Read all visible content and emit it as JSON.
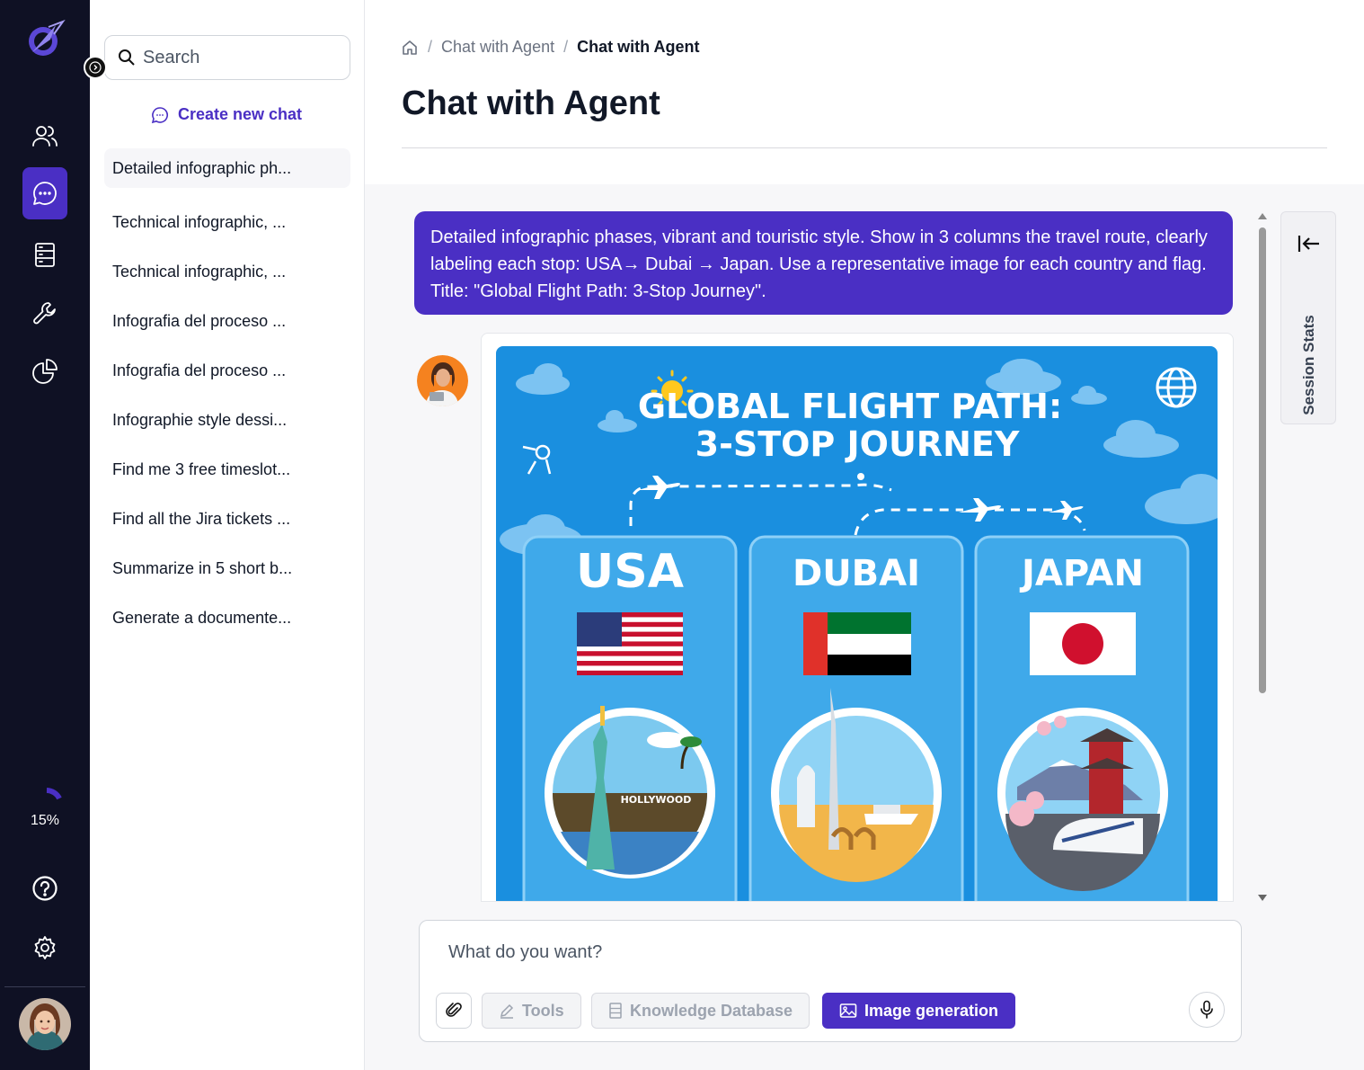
{
  "rail": {
    "usage_percent": 15,
    "usage_label": "15%",
    "nav": [
      "users-icon",
      "chat-icon",
      "database-icon",
      "tools-icon",
      "analytics-icon"
    ],
    "bottom": [
      "help-icon",
      "settings-icon"
    ]
  },
  "sidebar": {
    "search_placeholder": "Search",
    "new_chat_label": "Create new chat",
    "chats": [
      "Detailed infographic ph...",
      "Technical infographic, ...",
      "Technical infographic, ...",
      "Infografia del proceso ...",
      "Infografia del proceso ...",
      "Infographie style dessi...",
      "Find me 3 free timeslot...",
      "Find all the Jira tickets ...",
      "Summarize in 5 short b...",
      "Generate a documente..."
    ]
  },
  "breadcrumb": {
    "parent": "Chat with Agent",
    "current": "Chat with Agent"
  },
  "page_title": "Chat with Agent",
  "user_message": "Detailed infographic phases, vibrant and touristic style. Show in 3 columns the travel route, clearly labeling each stop: USA→ Dubai → Japan. Use a representative image for each country and flag. Title: \"Global Flight Path: 3-Stop Journey\".",
  "infographic": {
    "title_line1": "GLOBAL FLIGHT PATH:",
    "title_line2": "3-STOP JOURNEY",
    "stops": [
      "USA",
      "DUBAI",
      "JAPAN"
    ],
    "sign_text": "HOLLYWOOD"
  },
  "session_panel_label": "Session Stats",
  "composer": {
    "placeholder": "What do you want?",
    "tools_label": "Tools",
    "kb_label": "Knowledge Database",
    "image_label": "Image generation"
  },
  "colors": {
    "accent": "#4a2fc4",
    "rail_bg": "#0f1124",
    "sky": "#1a8fdf"
  }
}
